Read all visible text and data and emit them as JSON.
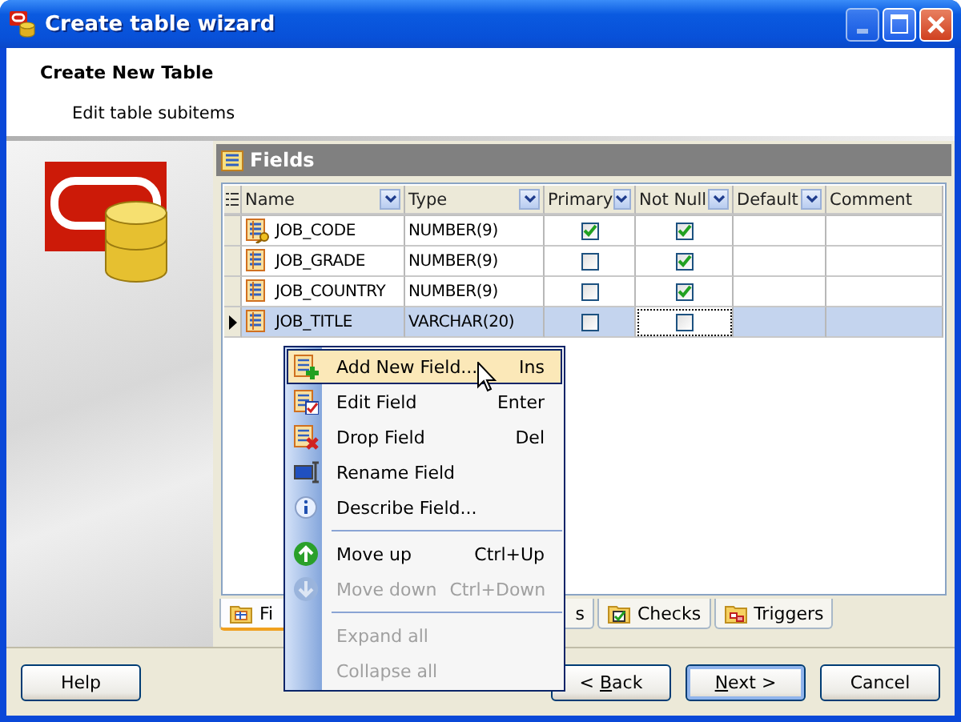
{
  "window": {
    "title": "Create table wizard"
  },
  "header": {
    "title": "Create New Table",
    "subtitle": "Edit table subitems"
  },
  "panel": {
    "title": "Fields"
  },
  "table": {
    "columns": [
      {
        "label": "Name",
        "filter": true
      },
      {
        "label": "Type",
        "filter": true
      },
      {
        "label": "Primary",
        "filter": true
      },
      {
        "label": "Not Null",
        "filter": true
      },
      {
        "label": "Default",
        "filter": true
      },
      {
        "label": "Comment",
        "filter": false
      }
    ],
    "rows": [
      {
        "name": "JOB_CODE",
        "type": "NUMBER(9)",
        "primary": true,
        "not_null": true,
        "selected": false
      },
      {
        "name": "JOB_GRADE",
        "type": "NUMBER(9)",
        "primary": false,
        "not_null": true,
        "selected": false
      },
      {
        "name": "JOB_COUNTRY",
        "type": "NUMBER(9)",
        "primary": false,
        "not_null": true,
        "selected": false
      },
      {
        "name": "JOB_TITLE",
        "type": "VARCHAR(20)",
        "primary": false,
        "not_null": false,
        "selected": true
      }
    ]
  },
  "tabs": [
    {
      "label": "Fi",
      "selected": true
    },
    {
      "label": "s",
      "selected": false
    },
    {
      "label": "Checks",
      "selected": false
    },
    {
      "label": "Triggers",
      "selected": false
    }
  ],
  "context_menu": {
    "items": [
      {
        "kind": "item",
        "label": "Add New Field...",
        "shortcut": "Ins",
        "disabled": false,
        "selected": true
      },
      {
        "kind": "item",
        "label": "Edit Field",
        "shortcut": "Enter",
        "disabled": false,
        "selected": false
      },
      {
        "kind": "item",
        "label": "Drop Field",
        "shortcut": "Del",
        "disabled": false,
        "selected": false
      },
      {
        "kind": "item",
        "label": "Rename Field",
        "disabled": false,
        "selected": false
      },
      {
        "kind": "item",
        "label": "Describe Field...",
        "disabled": false,
        "selected": false
      },
      {
        "kind": "separator"
      },
      {
        "kind": "item",
        "label": "Move up",
        "shortcut": "Ctrl+Up",
        "disabled": false,
        "selected": false
      },
      {
        "kind": "item",
        "label": "Move down",
        "shortcut": "Ctrl+Down",
        "disabled": true,
        "selected": false
      },
      {
        "kind": "separator"
      },
      {
        "kind": "item",
        "label": "Expand all",
        "disabled": true,
        "selected": false
      },
      {
        "kind": "item",
        "label": "Collapse all",
        "disabled": true,
        "selected": false
      }
    ]
  },
  "buttons": [
    {
      "kind": "help",
      "parts": [
        {
          "text": "Help",
          "underline": false
        }
      ],
      "default": false
    },
    {
      "kind": "back",
      "parts": [
        {
          "text": "< ",
          "underline": false
        },
        {
          "text": "B",
          "underline": true
        },
        {
          "text": "ack",
          "underline": false
        }
      ],
      "default": false
    },
    {
      "kind": "next",
      "parts": [
        {
          "text": "N",
          "underline": true
        },
        {
          "text": "ext >",
          "underline": false
        }
      ],
      "default": true
    },
    {
      "kind": "cancel",
      "parts": [
        {
          "text": "Cancel",
          "underline": false
        }
      ],
      "default": false
    }
  ]
}
